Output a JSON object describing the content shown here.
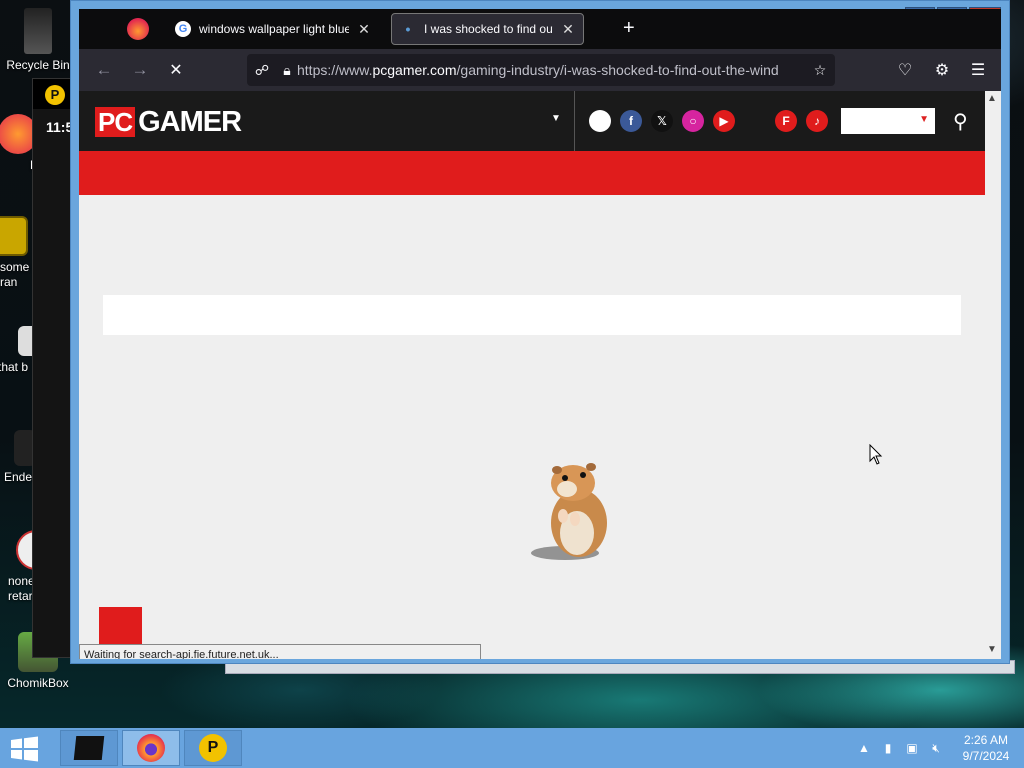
{
  "desktop": {
    "icons": [
      {
        "label": "Recycle Bin"
      },
      {
        "label": "Fi"
      },
      {
        "label": "some\nran"
      },
      {
        "label": "that b"
      },
      {
        "label": "Ende"
      },
      {
        "label": "none\nretar"
      },
      {
        "label": "ChomikBox"
      }
    ],
    "bg_window_clock": "11:5"
  },
  "browser": {
    "tabs": [
      {
        "title": "windows wallpaper light blue -",
        "close": "✕"
      },
      {
        "title": "I was shocked to find out the W",
        "close": "✕"
      }
    ],
    "new_tab": "+",
    "url_prefix": "https://www.",
    "url_domain": "pcgamer.com",
    "url_path": "/gaming-industry/i-was-shocked-to-find-out-the-wind",
    "status_text": "Waiting for search-api.fie.future.net.uk..."
  },
  "site": {
    "logo_pc": "PC",
    "logo_gamer": "GAMER",
    "colors": {
      "brand_red": "#e01c1c",
      "header_bg": "#1a1a1a"
    }
  },
  "taskbar": {
    "time": "2:26 AM",
    "date": "9/7/2024"
  }
}
